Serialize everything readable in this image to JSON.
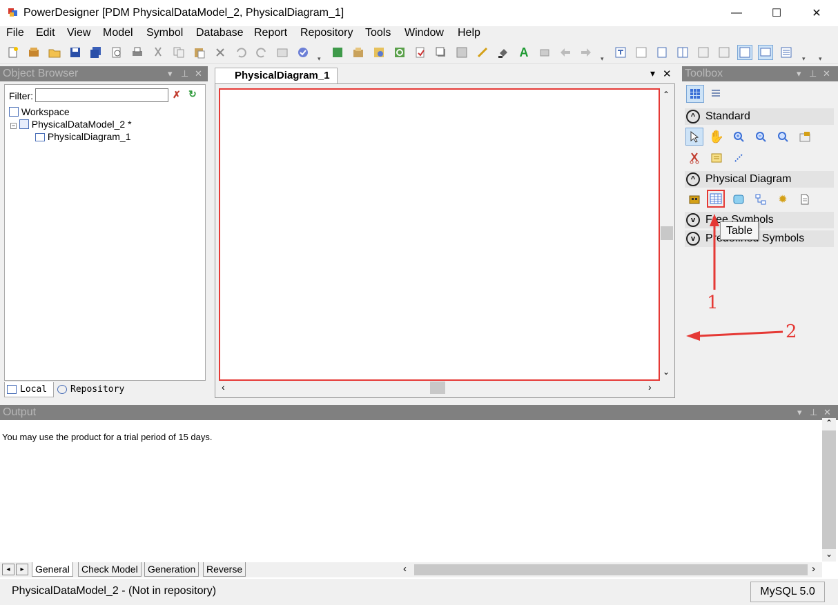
{
  "window": {
    "title": "PowerDesigner [PDM PhysicalDataModel_2, PhysicalDiagram_1]",
    "minimize": "—",
    "maximize": "☐",
    "close": "✕"
  },
  "menu": [
    "File",
    "Edit",
    "View",
    "Model",
    "Symbol",
    "Database",
    "Report",
    "Repository",
    "Tools",
    "Window",
    "Help"
  ],
  "object_browser": {
    "title": "Object Browser",
    "filter_label": "Filter:",
    "filter_value": "",
    "tree": [
      "Workspace",
      "PhysicalDataModel_2 *",
      "PhysicalDiagram_1"
    ],
    "tabs": [
      "Local",
      "Repository"
    ]
  },
  "diagram": {
    "tab_label": "PhysicalDiagram_1"
  },
  "toolbox": {
    "title": "Toolbox",
    "sections": [
      {
        "label": "Standard",
        "expanded": true
      },
      {
        "label": "Physical Diagram",
        "expanded": true
      },
      {
        "label": "Free Symbols",
        "expanded": false
      },
      {
        "label": "Predefined Symbols",
        "expanded": false
      }
    ],
    "tooltip": "Table"
  },
  "annotations": {
    "label_1": "1",
    "label_2": "2",
    "color": "#e53935"
  },
  "output": {
    "title": "Output",
    "message": "You may use the product for a trial period of 15 days.",
    "tabs": [
      "General",
      "Check Model",
      "Generation",
      "Reverse"
    ]
  },
  "status": {
    "left": "PhysicalDataModel_2 - (Not in repository)",
    "right": "MySQL 5.0"
  }
}
